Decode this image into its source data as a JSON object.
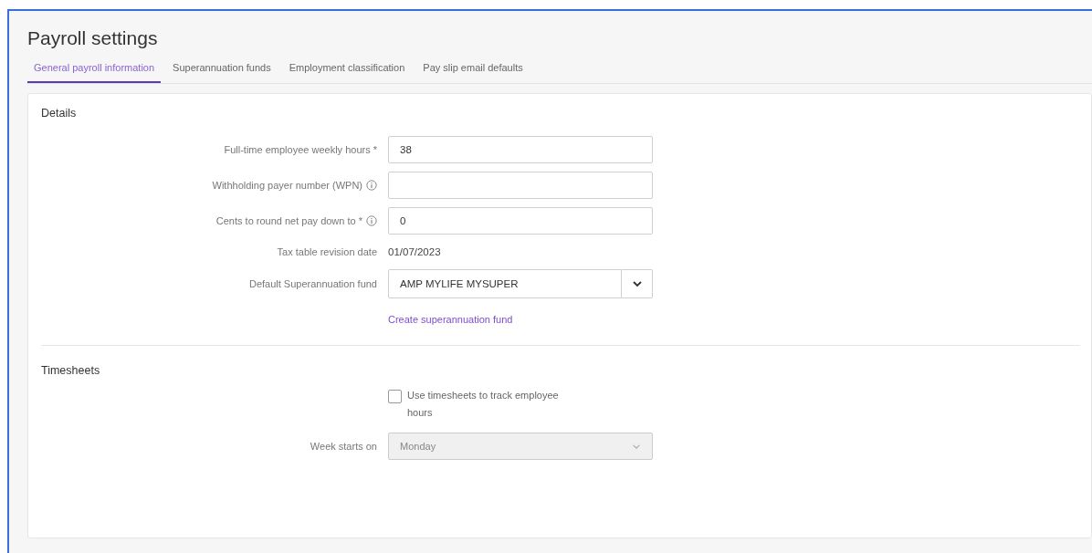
{
  "page": {
    "title": "Payroll settings"
  },
  "tabs": [
    {
      "label": "General payroll information",
      "selected": true
    },
    {
      "label": "Superannuation funds",
      "selected": false
    },
    {
      "label": "Employment classification",
      "selected": false
    },
    {
      "label": "Pay slip email defaults",
      "selected": false
    }
  ],
  "details": {
    "heading": "Details",
    "fields": [
      {
        "kind": "input",
        "label": "Full-time employee weekly hours *",
        "info": false,
        "value": "38"
      },
      {
        "kind": "input",
        "label": "Withholding payer number (WPN)",
        "info": true
      },
      {
        "kind": "input",
        "label": "Cents to round net pay down to *",
        "info": true,
        "value": "0"
      },
      {
        "kind": "text",
        "label": "Tax table revision date",
        "info": false,
        "value": "01/07/2023"
      },
      {
        "kind": "select",
        "label": "Default Superannuation fund",
        "info": false,
        "value": "AMP MYLIFE MYSUPER"
      }
    ],
    "link": "Create superannuation fund"
  },
  "timesheets": {
    "heading": "Timesheets",
    "checkbox": {
      "label": "Use timesheets to track employee hours",
      "checked": false
    },
    "week_starts": {
      "label": "Week starts on",
      "value": "Monday",
      "disabled": true
    }
  }
}
